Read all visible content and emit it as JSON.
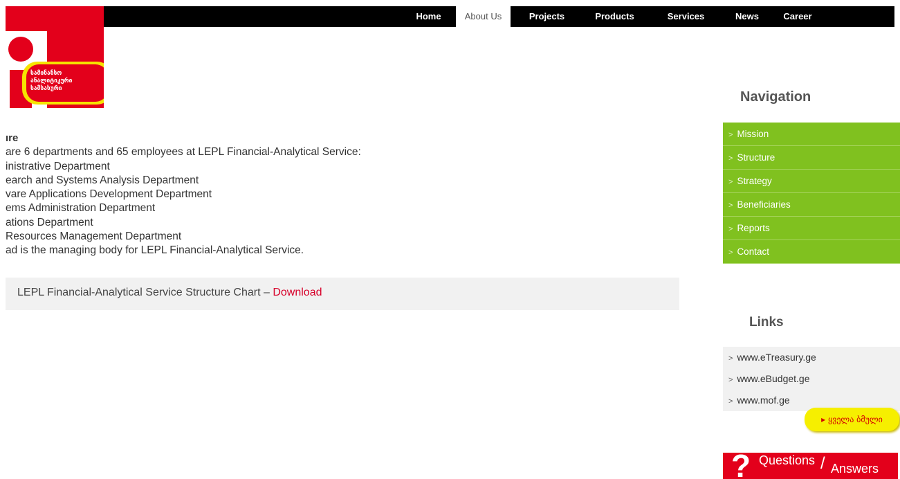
{
  "nav": {
    "items": [
      {
        "label": "Home"
      },
      {
        "label": "About Us",
        "active": true
      },
      {
        "label": "Projects"
      },
      {
        "label": "Products"
      },
      {
        "label": "Services"
      },
      {
        "label": "News"
      },
      {
        "label": "Career"
      }
    ]
  },
  "logo": {
    "lines": [
      "სამინანსო",
      "ანალიტიკური",
      "სამსახური"
    ]
  },
  "main": {
    "heading": "ıre",
    "lines": [
      "are 6 departments and 65 employees at LEPL Financial-Analytical Service:",
      "inistrative Department",
      "earch and Systems Analysis Department",
      "vare Applications Development Department",
      "ems Administration Department",
      "ations Department",
      " Resources Management Department",
      "ad is the managing body for LEPL Financial-Analytical Service."
    ],
    "download_text": "LEPL Financial-Analytical Service Structure Chart – ",
    "download_link": "Download"
  },
  "sidebar": {
    "nav_title": "Navigation",
    "nav_items": [
      "Mission",
      "Structure",
      "Strategy",
      "Beneficiaries",
      "Reports",
      "Contact"
    ],
    "links_title": "Links",
    "links": [
      "www.eTreasury.ge",
      "www.eBudget.ge",
      "www.mof.ge"
    ],
    "old_version": "▸ ყველა ბმული",
    "qa": {
      "part1": "Questions",
      "slash": "/",
      "part2": "Answers"
    }
  },
  "colors": {
    "brand_red": "#e3001b",
    "nav_green": "#80c11f",
    "link_red": "#d7002a",
    "yellow": "#f6ef00"
  }
}
